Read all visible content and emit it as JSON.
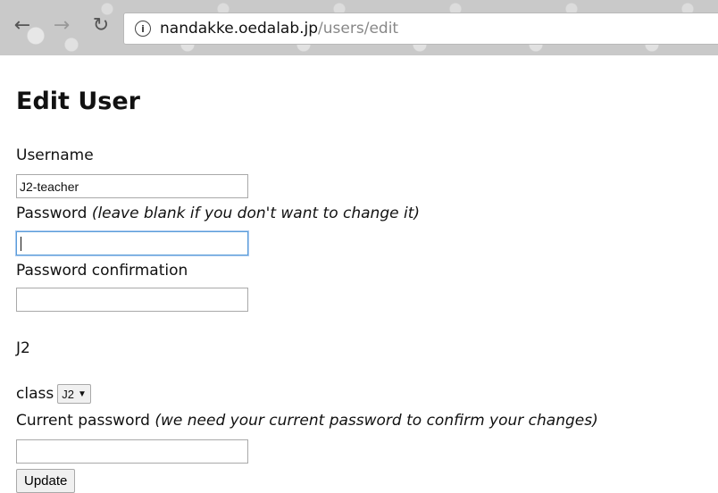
{
  "browser": {
    "url_host": "nandakke.oedalab.jp",
    "url_path": "/users/edit",
    "icons": {
      "back": "back-arrow-icon",
      "forward": "forward-arrow-icon",
      "reload": "reload-icon",
      "info": "info-icon"
    }
  },
  "form": {
    "title": "Edit User",
    "username_label": "Username",
    "username_value": "J2-teacher",
    "password_label": "Password",
    "password_hint": "(leave blank if you don't want to change it)",
    "password_value": "",
    "password_confirmation_label": "Password confirmation",
    "password_confirmation_value": "",
    "group_text": "J2",
    "class_label": "class",
    "class_selected": "J2",
    "current_password_label": "Current password",
    "current_password_hint": "(we need your current password to confirm your changes)",
    "current_password_value": "",
    "update_label": "Update"
  },
  "colors": {
    "focus_border": "#5b9dd9",
    "chrome_background": "#c9c9c9"
  }
}
